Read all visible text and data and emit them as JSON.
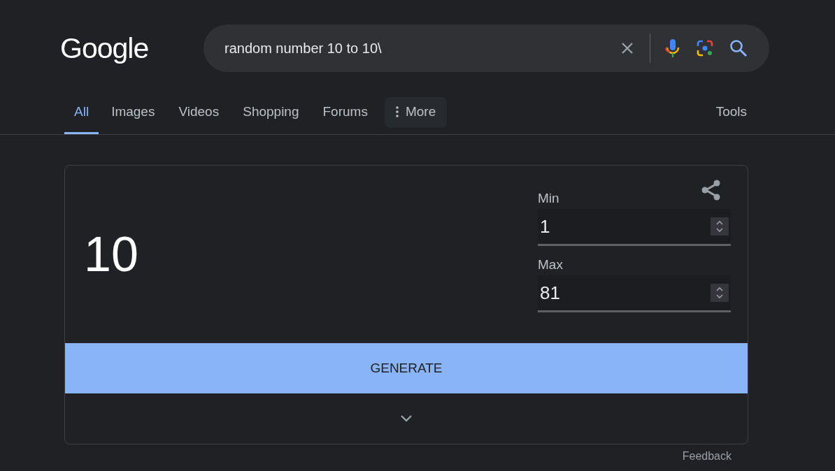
{
  "logo": "Google",
  "search": {
    "value": "random number 10 to 10\\"
  },
  "tabs": [
    {
      "label": "All",
      "selected": true,
      "kind": "tab"
    },
    {
      "label": "Images",
      "selected": false,
      "kind": "tab"
    },
    {
      "label": "Videos",
      "selected": false,
      "kind": "tab"
    },
    {
      "label": "Shopping",
      "selected": false,
      "kind": "tab"
    },
    {
      "label": "Forums",
      "selected": false,
      "kind": "tab"
    },
    {
      "label": "More",
      "selected": false,
      "kind": "menu"
    }
  ],
  "tools": "Tools",
  "generator": {
    "result": "10",
    "fields": [
      {
        "label": "Min",
        "value": "1"
      },
      {
        "label": "Max",
        "value": "81"
      }
    ],
    "button": "GENERATE"
  },
  "feedback": "Feedback"
}
